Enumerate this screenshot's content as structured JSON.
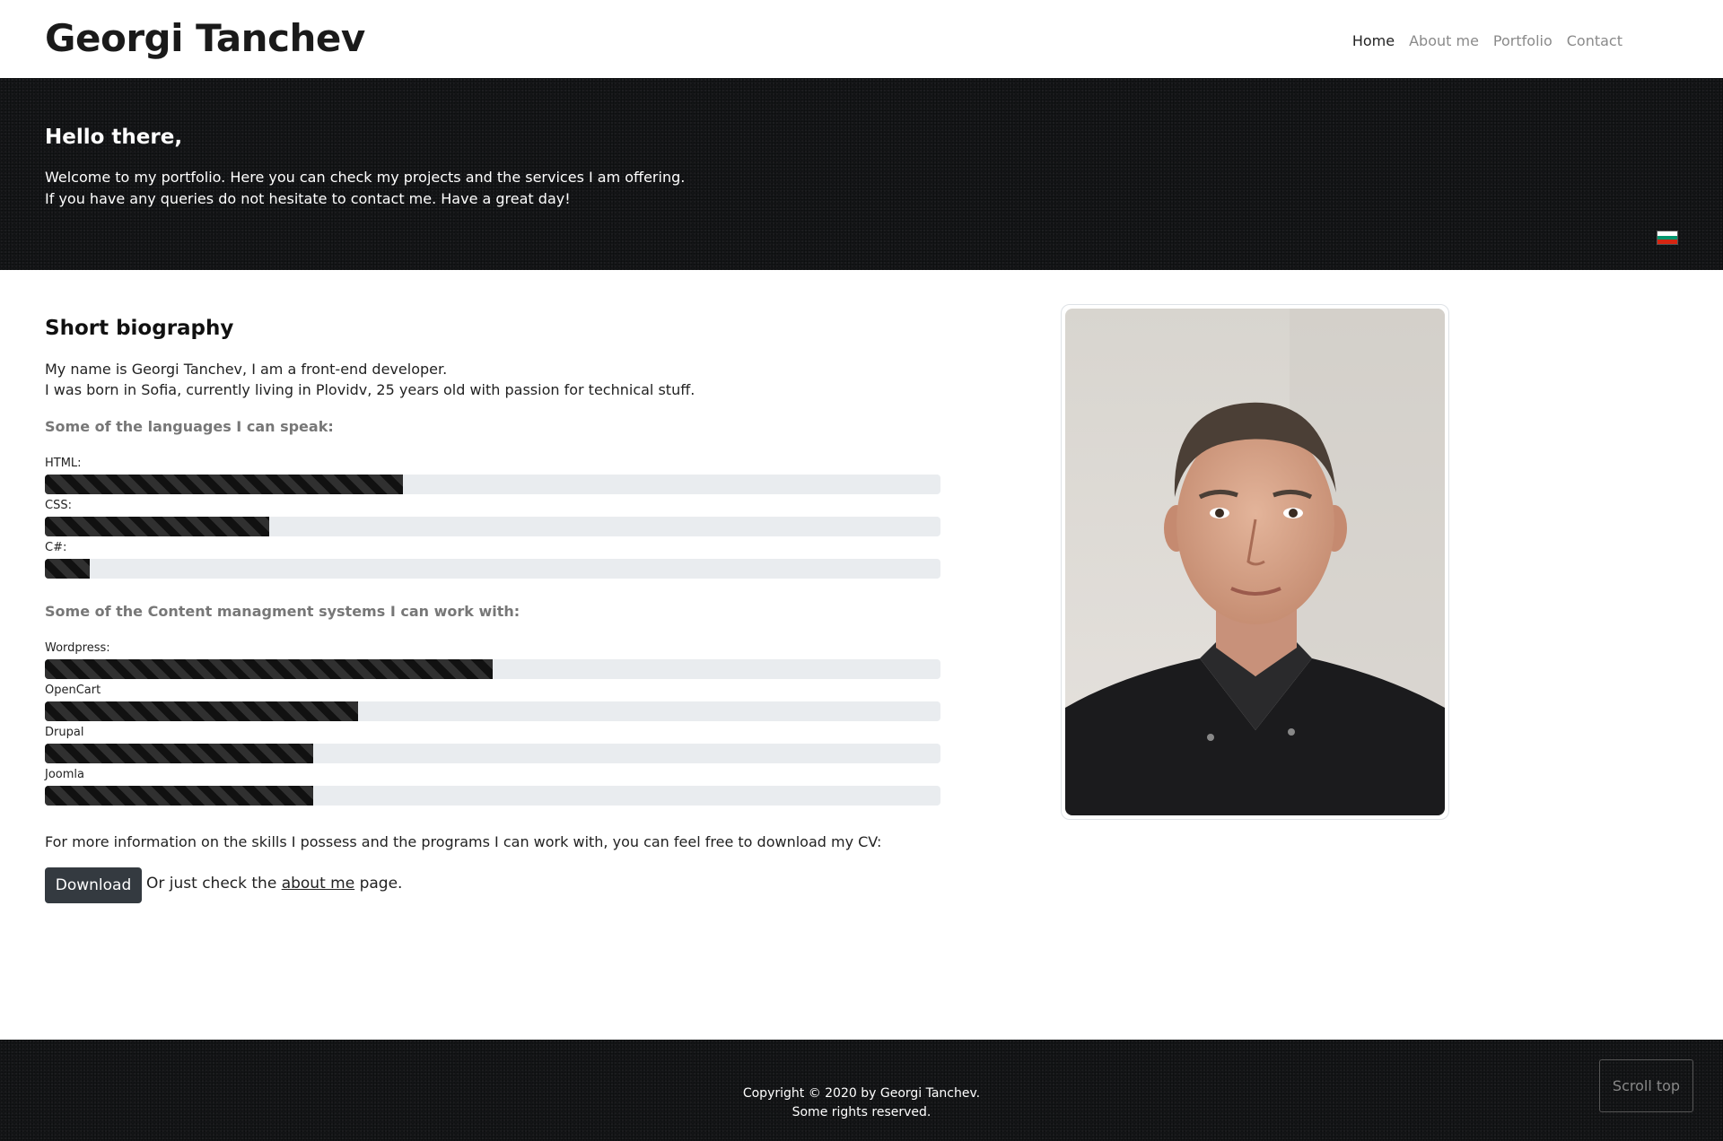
{
  "brand": "Georgi Tanchev",
  "nav": {
    "items": [
      "Home",
      "About me",
      "Portfolio",
      "Contact"
    ],
    "active": "Home"
  },
  "hero": {
    "title": "Hello there,",
    "line1": "Welcome to my portfolio. Here you can check my projects and the services I am offering.",
    "line2": "If you have any queries do not hesitate to contact me. Have a great day!",
    "flag_colors": [
      "#ffffff",
      "#00966e",
      "#d62612"
    ]
  },
  "bio": {
    "title": "Short biography",
    "line1": "My name is Georgi Tanchev, I am a front-end developer.",
    "line2": "I was born in Sofia, currently living in Plovidv, 25 years old with passion for technical stuff.",
    "languages_title": "Some of the languages I can speak:",
    "languages": [
      {
        "label": "HTML:",
        "level": 0.4
      },
      {
        "label": "CSS:",
        "level": 0.25
      },
      {
        "label": "C#:",
        "level": 0.05
      }
    ],
    "cms_title": "Some of the Content managment systems I can work with:",
    "cms": [
      {
        "label": "Wordpress:",
        "level": 0.5
      },
      {
        "label": "OpenCart",
        "level": 0.35
      },
      {
        "label": "Drupal",
        "level": 0.3
      },
      {
        "label": "Joomla",
        "level": 0.3
      }
    ],
    "more_info": "For more information on the skills I possess and the programs I can work with, you can feel free to download my CV:",
    "download_label": "Download",
    "note_before": "Or just check the",
    "note_link": "about me",
    "note_after": "page."
  },
  "footer": {
    "line1": "Copyright © 2020 by Georgi Tanchev.",
    "line2": "Some rights reserved.",
    "scroll_top": "Scroll top"
  },
  "colors": {
    "dark_bg": "#141517",
    "progress_fill": "#111111",
    "button": "#343a40"
  }
}
